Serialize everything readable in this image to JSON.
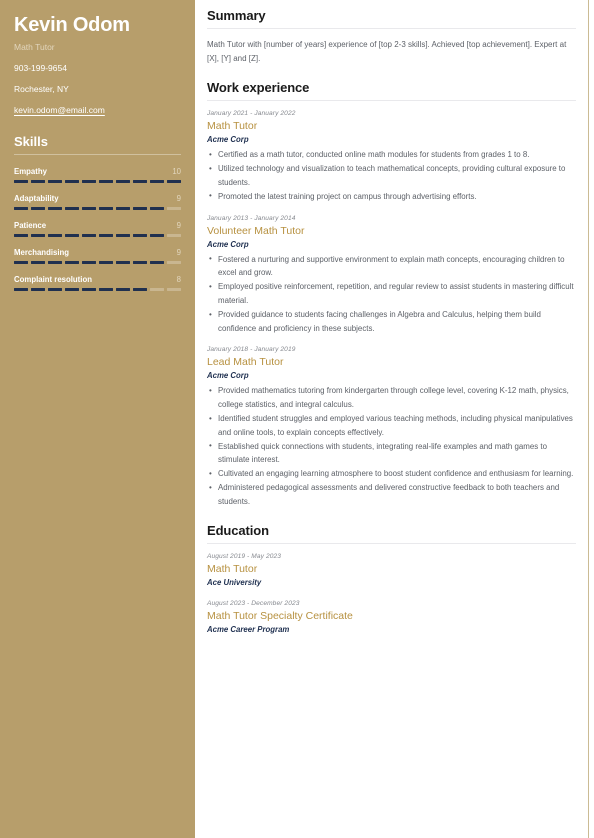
{
  "sidebar": {
    "name": "Kevin Odom",
    "role": "Math Tutor",
    "phone": "903-199-9654",
    "location": "Rochester, NY",
    "email": "kevin.odom@email.com",
    "skills_heading": "Skills",
    "skills_max": 10,
    "skills": [
      {
        "label": "Empathy",
        "score": 10
      },
      {
        "label": "Adaptability",
        "score": 9
      },
      {
        "label": "Patience",
        "score": 9
      },
      {
        "label": "Merchandising",
        "score": 9
      },
      {
        "label": "Complaint resolution",
        "score": 8
      }
    ]
  },
  "main": {
    "summary": {
      "heading": "Summary",
      "text": "Math Tutor with [number of years] experience of [top 2-3 skills]. Achieved [top achievement]. Expert at [X], [Y] and [Z]."
    },
    "work": {
      "heading": "Work experience",
      "entries": [
        {
          "date": "January 2021 - January 2022",
          "title": "Math Tutor",
          "org": "Acme Corp",
          "bullets": [
            "Certified as a math tutor, conducted online math modules for students from grades 1 to 8.",
            "Utilized technology and visualization to teach mathematical concepts, providing cultural exposure to students.",
            "Promoted the latest training project on campus through advertising efforts."
          ]
        },
        {
          "date": "January 2013 - January 2014",
          "title": "Volunteer Math Tutor",
          "org": "Acme Corp",
          "bullets": [
            "Fostered a nurturing and supportive environment to explain math concepts, encouraging children to excel and grow.",
            "Employed positive reinforcement, repetition, and regular review to assist students in mastering difficult material.",
            "Provided guidance to students facing challenges in Algebra and Calculus, helping them build confidence and proficiency in these subjects."
          ]
        },
        {
          "date": "January 2018 - January 2019",
          "title": "Lead Math Tutor",
          "org": "Acme Corp",
          "bullets": [
            "Provided mathematics tutoring from kindergarten through college level, covering K-12 math, physics, college statistics, and integral calculus.",
            "Identified student struggles and employed various teaching methods, including physical manipulatives and online tools, to explain concepts effectively.",
            "Established quick connections with students, integrating real-life examples and math games to stimulate interest.",
            "Cultivated an engaging learning atmosphere to boost student confidence and enthusiasm for learning.",
            "Administered pedagogical assessments and delivered constructive feedback to both teachers and students."
          ]
        }
      ]
    },
    "education": {
      "heading": "Education",
      "entries": [
        {
          "date": "August 2019 - May 2023",
          "title": "Math Tutor",
          "org": "Ace University"
        },
        {
          "date": "August 2023 - December 2023",
          "title": "Math Tutor Specialty Certificate",
          "org": "Acme Career Program"
        }
      ]
    }
  },
  "theme": {
    "sidebar_bg": "#b79e6b",
    "accent_gold": "#b79140",
    "navy": "#1f3050",
    "body_text": "#5d6168"
  }
}
